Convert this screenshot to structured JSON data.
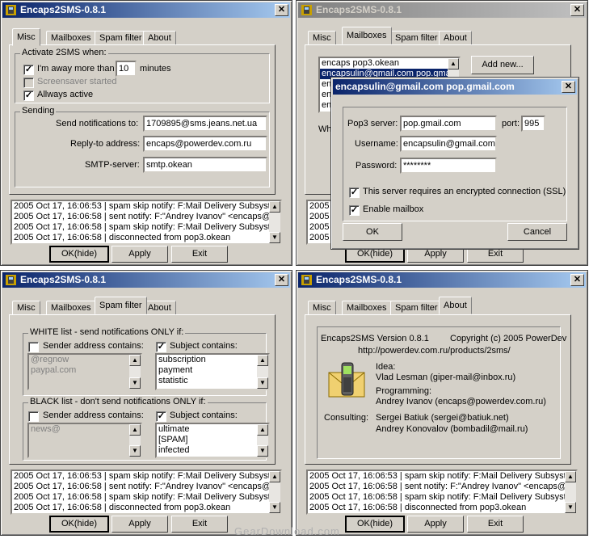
{
  "app_title": "Encaps2SMS-0.8.1",
  "close_glyph": "✕",
  "tabs": [
    "Misc",
    "Mailboxes",
    "Spam filter",
    "About"
  ],
  "buttons": {
    "ok": "OK(hide)",
    "apply": "Apply",
    "exit": "Exit"
  },
  "log": [
    "2005 Oct 17, 16:06:53 | spam skip notify: F:Mail Delivery Subsystem",
    "2005 Oct 17, 16:06:58 | sent notify: F:\"Andrey Ivanov\" <encaps@powerdev",
    "2005 Oct 17, 16:06:58 | spam skip notify: F:Mail Delivery Subsystem",
    "2005 Oct 17, 16:06:58 | disconnected from pop3.okean"
  ],
  "misc": {
    "activate_title": "Activate 2SMS when:",
    "away_label": "I'm away more than",
    "away_value": "10",
    "minutes": "minutes",
    "screensaver": "Screensaver started",
    "always": "Allways active",
    "sending_title": "Sending",
    "notify_label": "Send notifications to:",
    "notify_value": "1709895@sms.jeans.net.ua",
    "reply_label": "Reply-to address:",
    "reply_value": "encaps@powerdev.com.ru",
    "smtp_label": "SMTP-server:",
    "smtp_value": "smtp.okean"
  },
  "mailboxes": {
    "list": [
      "encaps pop3.okean",
      "encapsulin@gmail.com pop.gmail",
      "en",
      "en",
      "en"
    ],
    "add_new": "Add new...",
    "wh_text": "Wh",
    "dialog": {
      "title": "encapsulin@gmail.com pop.gmail.com",
      "pop3_label": "Pop3 server:",
      "pop3_value": "pop.gmail.com",
      "port_label": "port:",
      "port_value": "995",
      "user_label": "Username:",
      "user_value": "encapsulin@gmail.com",
      "pass_label": "Password:",
      "pass_value": "********",
      "ssl": "This server requires an encrypted connection (SSL)",
      "enable": "Enable mailbox",
      "ok": "OK",
      "cancel": "Cancel"
    }
  },
  "spam": {
    "white_title": "WHITE list - send notifications ONLY if:",
    "black_title": "BLACK list - don't send notifications ONLY if:",
    "sender_label": "Sender address contains:",
    "subject_label": "Subject contains:",
    "white_senders": [
      "@regnow",
      "paypal.com"
    ],
    "white_subjects": [
      "subscription",
      "payment",
      "statistic"
    ],
    "black_senders": [
      "news@"
    ],
    "black_subjects": [
      "ultimate",
      "[SPAM]",
      "infected"
    ]
  },
  "about": {
    "version": "Encaps2SMS Version 0.8.1",
    "copyright": "Copyright (c) 2005 PowerDev",
    "url": "http://powerdev.com.ru/products/2sms/",
    "idea_label": "Idea:",
    "idea_value": "Vlad Lesman (giper-mail@inbox.ru)",
    "prog_label": "Programming:",
    "prog_value": "Andrey Ivanov (encaps@powerdev.com.ru)",
    "consult_label": "Consulting:",
    "consult_value1": "Sergei Batiuk (sergei@batiuk.net)",
    "consult_value2": "Andrey Konovalov (bombadil@mail.ru)"
  },
  "watermark": "GearDownload.com",
  "colors": {
    "title_active": "#0a246a",
    "title_inactive": "#808080",
    "selection": "#0a246a",
    "face": "#d4d0c8"
  },
  "icons": [
    "app-icon",
    "close-icon",
    "mobile-phone-envelope-icon",
    "scroll-up-icon",
    "scroll-down-icon"
  ]
}
